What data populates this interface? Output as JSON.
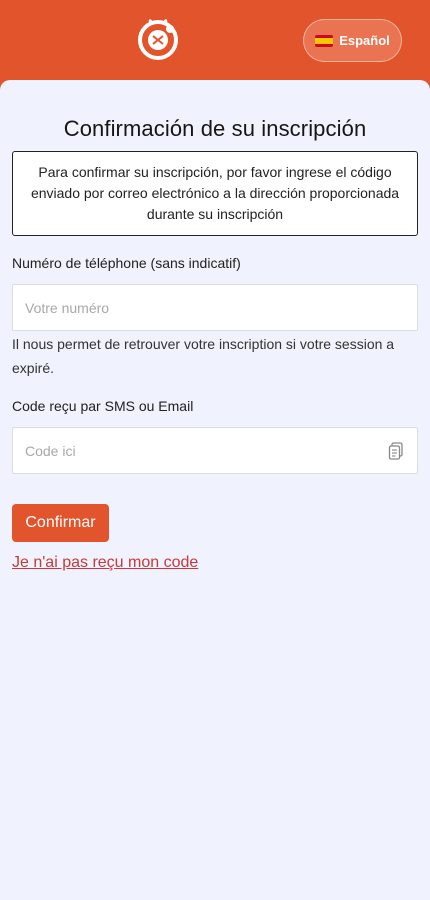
{
  "header": {
    "logo_icon": "lobster-logo-icon",
    "language": {
      "label": "Español",
      "flag_icon": "spain-flag-icon"
    }
  },
  "main": {
    "title": "Confirmación de su inscripción",
    "info": "Para confirmar su inscripción, por favor ingrese el código enviado por correo electrónico a la dirección proporcionada durante su inscripción",
    "phone": {
      "label": "Numéro de téléphone (sans indicatif)",
      "placeholder": "Votre numéro",
      "value": "",
      "help": "Il nous permet de retrouver votre inscription si votre session a expiré."
    },
    "code": {
      "label": "Code reçu par SMS ou Email",
      "placeholder": "Code ici",
      "value": "",
      "icon": "paste-icon"
    },
    "confirm_label": "Confirmar",
    "resend_label": "Je n'ai pas reçu mon code"
  },
  "colors": {
    "brand": "#e2542b",
    "background": "#f0f2fd",
    "link": "#c8393a"
  }
}
